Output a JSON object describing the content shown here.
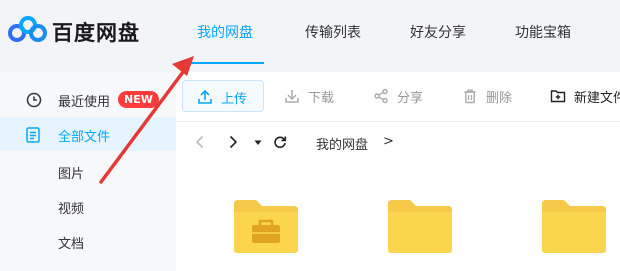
{
  "app": {
    "name": "百度网盘",
    "brand_color": "#06a7ff"
  },
  "top_tabs": [
    {
      "label": "我的网盘",
      "active": true
    },
    {
      "label": "传输列表"
    },
    {
      "label": "好友分享"
    },
    {
      "label": "功能宝箱"
    }
  ],
  "sidebar": {
    "recent": {
      "label": "最近使用",
      "badge": "NEW",
      "icon": "clock-icon"
    },
    "all_files": {
      "label": "全部文件",
      "icon": "document-icon",
      "active": true
    },
    "sub_items": [
      "图片",
      "视频",
      "文档"
    ]
  },
  "toolbar": {
    "upload": "上传",
    "download": "下载",
    "share": "分享",
    "delete": "删除",
    "new_folder": "新建文件"
  },
  "pathbar": {
    "path": "我的网盘",
    "separator": ">"
  },
  "folders": [
    {
      "icon": "toolbox-folder-icon"
    },
    {
      "icon": "folder-icon"
    },
    {
      "icon": "folder-icon"
    }
  ],
  "annotation": {
    "color": "#e53935",
    "icon": "red-arrow-pointer"
  }
}
